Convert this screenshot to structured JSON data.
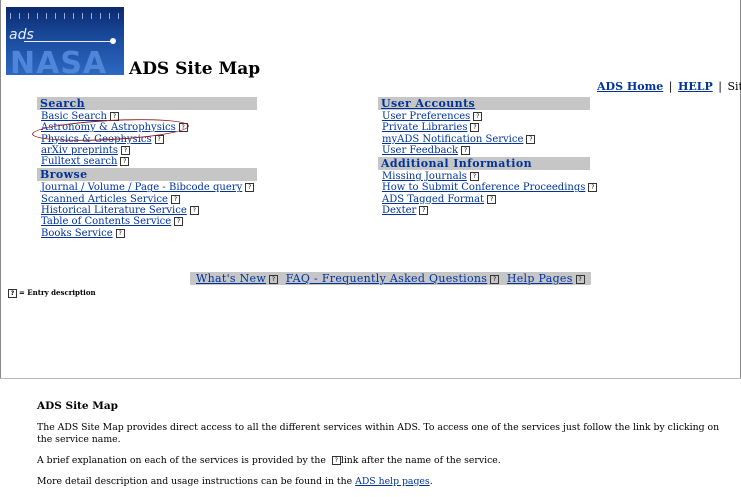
{
  "logo": {
    "ads_text": "ads",
    "nasa_text": "NASA"
  },
  "page_title": "ADS Site Map",
  "topnav": {
    "home": "ADS Home",
    "help": "HELP",
    "sitemap": "Sitemap",
    "separator": "|"
  },
  "search": {
    "header": "Search",
    "items": [
      "Basic Search",
      "Astronomy & Astrophysics",
      "Physics & Geophysics",
      "arXiv preprints",
      "Fulltext search"
    ]
  },
  "browse": {
    "header": "Browse",
    "items": [
      "Journal / Volume / Page - Bibcode query",
      "Scanned Articles Service",
      "Historical Literature Service",
      "Table of Contents Service",
      "Books Service"
    ]
  },
  "user_accounts": {
    "header": "User Accounts",
    "items": [
      "User Preferences",
      "Private Libraries",
      "myADS Notification Service",
      "User Feedback"
    ]
  },
  "additional_info": {
    "header": "Additional Information",
    "items": [
      "Missing Journals",
      "How to Submit Conference Proceedings",
      "ADS Tagged Format",
      "Dexter"
    ]
  },
  "bottom_nav": {
    "whats_new": "What's New",
    "faq": "FAQ - Frequently Asked Questions",
    "help_pages": "Help Pages"
  },
  "legend": "= Entry description",
  "description": {
    "title": "ADS Site Map",
    "p1": "The ADS Site Map provides direct access to all the different services within ADS. To access one of the services just follow the link by clicking on the service name.",
    "p2_a": "A brief explanation on each of the services is provided by the",
    "p2_b": "link after the name of the service.",
    "p3_a": "More detail description and usage instructions can be found in the",
    "p3_link": "ADS help pages",
    "p3_b": "."
  },
  "colors": {
    "link": "#003399",
    "header_bg": "#c6c6c6",
    "highlight": "#8b1a1a"
  }
}
